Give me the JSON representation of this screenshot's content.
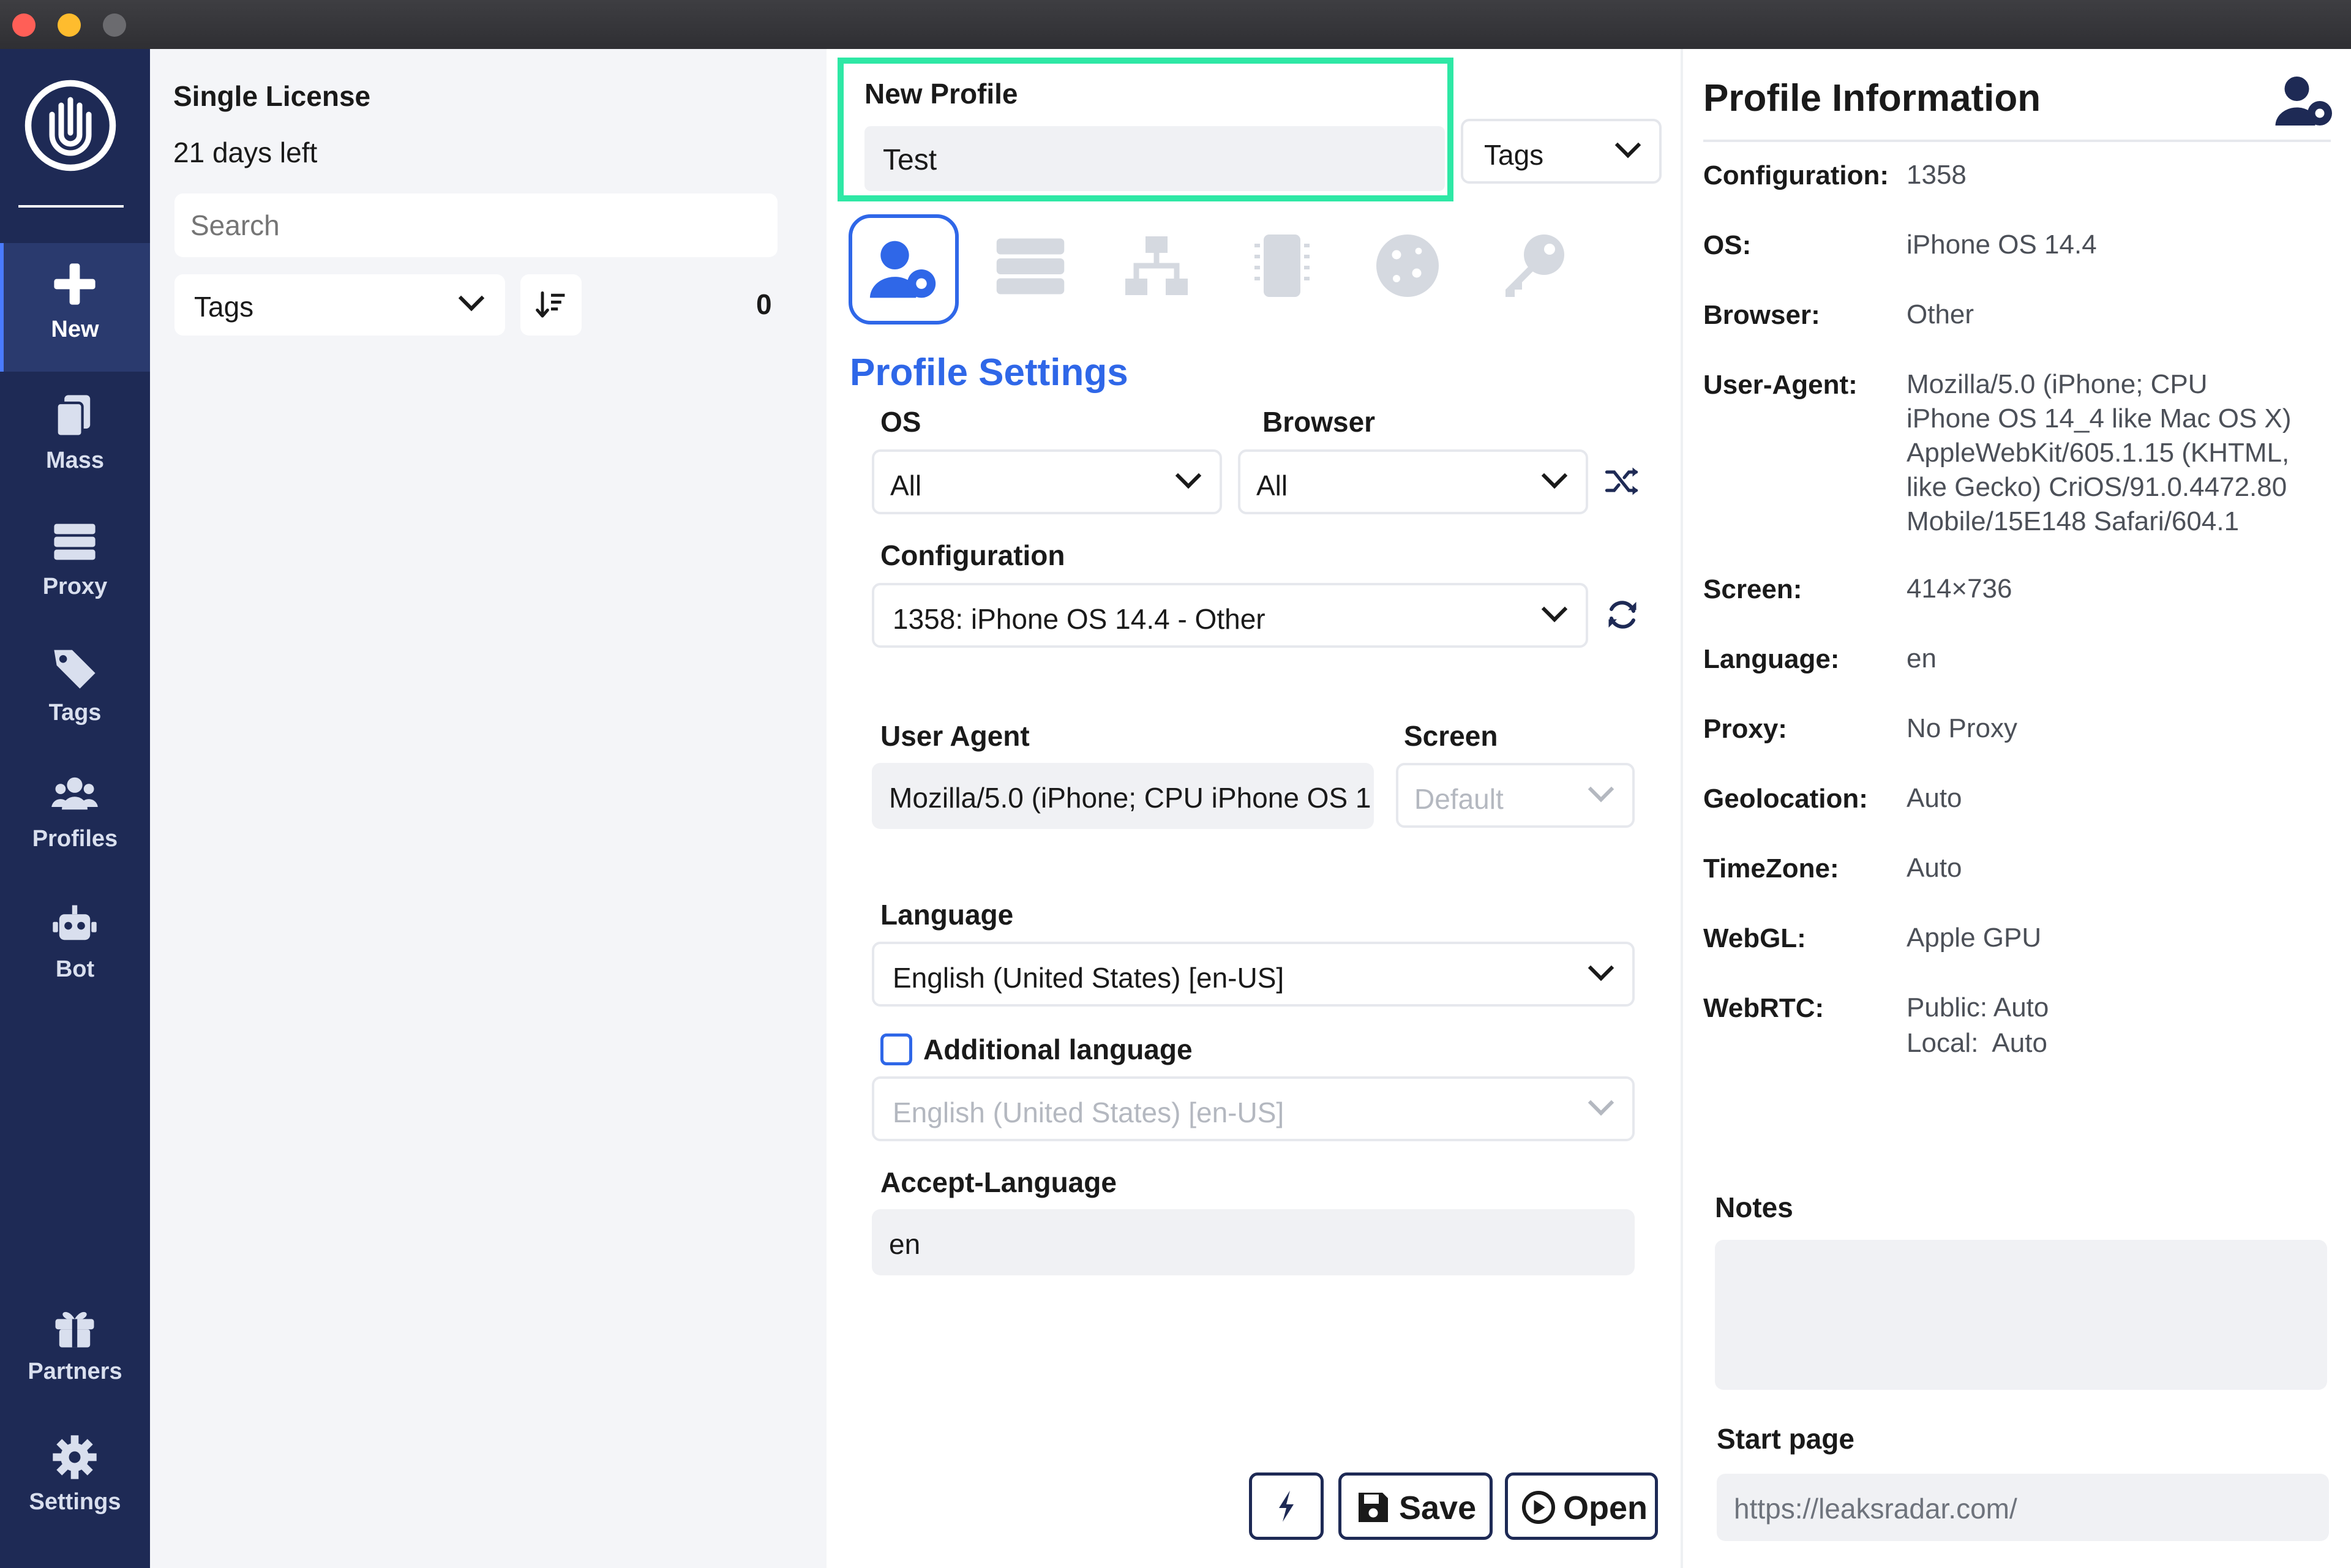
{
  "sidebar": {
    "items": [
      {
        "label": "New",
        "icon": "plus-icon",
        "active": true
      },
      {
        "label": "Mass",
        "icon": "copy-icon"
      },
      {
        "label": "Proxy",
        "icon": "server-icon"
      },
      {
        "label": "Tags",
        "icon": "tags-icon"
      },
      {
        "label": "Profiles",
        "icon": "users-icon"
      },
      {
        "label": "Bot",
        "icon": "robot-icon"
      }
    ],
    "bottom_items": [
      {
        "label": "Partners",
        "icon": "gift-icon"
      },
      {
        "label": "Settings",
        "icon": "gear-icon"
      }
    ]
  },
  "license": {
    "title": "Single License",
    "days_left": "21 days left"
  },
  "list": {
    "search_placeholder": "Search",
    "tags_label": "Tags",
    "count": "0"
  },
  "profile": {
    "new_profile_label": "New Profile",
    "name_value": "Test",
    "tags_label": "Tags",
    "settings_title": "Profile Settings",
    "os_label": "OS",
    "os_value": "All",
    "browser_label": "Browser",
    "browser_value": "All",
    "configuration_label": "Configuration",
    "configuration_value": "1358: iPhone OS 14.4 - Other",
    "user_agent_label": "User Agent",
    "user_agent_value": "Mozilla/5.0 (iPhone; CPU iPhone OS 1",
    "screen_label": "Screen",
    "screen_placeholder": "Default",
    "language_label": "Language",
    "language_value": "English (United States) [en-US]",
    "additional_language_label": "Additional language",
    "additional_language_value": "English (United States) [en-US]",
    "accept_language_label": "Accept-Language",
    "accept_language_value": "en"
  },
  "actions": {
    "save_label": "Save",
    "open_label": "Open"
  },
  "info": {
    "title": "Profile Information",
    "rows": [
      {
        "key": "Configuration:",
        "value": "1358"
      },
      {
        "key": "OS:",
        "value": "iPhone OS 14.4"
      },
      {
        "key": "Browser:",
        "value": "Other"
      },
      {
        "key": "User-Agent:",
        "lines": [
          "Mozilla/5.0 (iPhone; CPU",
          "iPhone OS 14_4 like Mac OS X)",
          "AppleWebKit/605.1.15 (KHTML,",
          "like Gecko) CriOS/91.0.4472.80",
          "Mobile/15E148 Safari/604.1"
        ]
      },
      {
        "key": "Screen:",
        "value": "414×736"
      },
      {
        "key": "Language:",
        "value": "en"
      },
      {
        "key": "Proxy:",
        "value": "No Proxy"
      },
      {
        "key": "Geolocation:",
        "value": "Auto"
      },
      {
        "key": "TimeZone:",
        "value": "Auto"
      },
      {
        "key": "WebGL:",
        "value": "Apple GPU"
      },
      {
        "key": "WebRTC:",
        "lines": [
          "Public: Auto",
          "Local:  Auto"
        ]
      }
    ],
    "notes_label": "Notes",
    "start_page_label": "Start page",
    "start_page_value": "https://leaksradar.com/"
  },
  "colors": {
    "sidebar": "#1e2a55",
    "accent": "#2f67e8",
    "highlight": "#2ee8a5"
  }
}
